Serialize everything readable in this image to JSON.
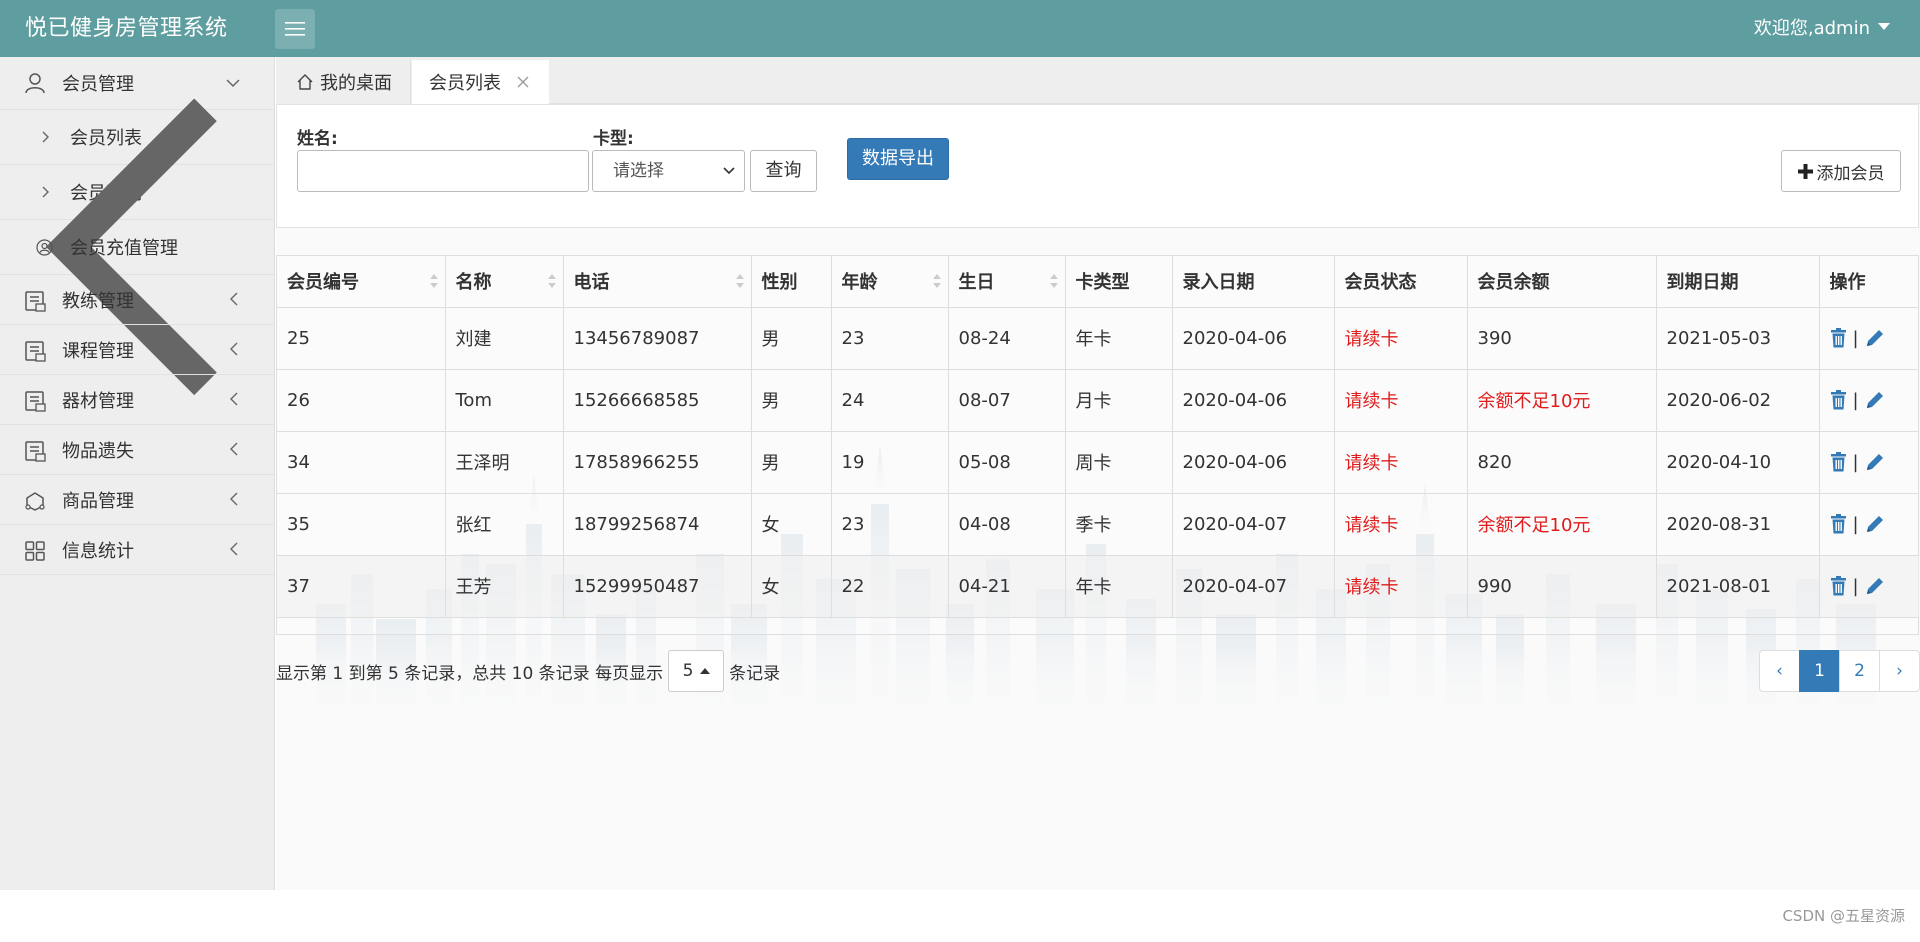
{
  "header": {
    "title": "悦已健身房管理系统",
    "welcome": "欢迎您,admin"
  },
  "sidebar": {
    "items": [
      {
        "label": "会员管理",
        "icon": "user-icon",
        "expanded": true,
        "children": [
          {
            "label": "会员列表"
          },
          {
            "label": "会员到期"
          }
        ]
      },
      {
        "label": "会员充值管理",
        "icon": "circle-user-icon"
      },
      {
        "label": "教练管理",
        "icon": "document-icon"
      },
      {
        "label": "课程管理",
        "icon": "document-icon"
      },
      {
        "label": "器材管理",
        "icon": "document-icon"
      },
      {
        "label": "物品遗失",
        "icon": "document-icon"
      },
      {
        "label": "商品管理",
        "icon": "goods-icon"
      },
      {
        "label": "信息统计",
        "icon": "grid-icon"
      }
    ]
  },
  "tabs": {
    "home": "我的桌面",
    "active": "会员列表"
  },
  "search": {
    "name_label": "姓名:",
    "name_value": "",
    "card_label": "卡型:",
    "card_selected": "请选择",
    "query_button": "查询",
    "export_button": "数据导出",
    "add_button": "添加会员"
  },
  "table": {
    "columns": [
      "会员编号",
      "名称",
      "电话",
      "性别",
      "年龄",
      "生日",
      "卡类型",
      "录入日期",
      "会员状态",
      "会员余额",
      "到期日期",
      "操作"
    ],
    "rows": [
      [
        "25",
        "刘建",
        "13456789087",
        "男",
        "23",
        "08-24",
        "年卡",
        "2020-04-06",
        "请续卡",
        "390",
        "2021-05-03"
      ],
      [
        "26",
        "Tom",
        "15266668585",
        "男",
        "24",
        "08-07",
        "月卡",
        "2020-04-06",
        "请续卡",
        "余额不足10元",
        "2020-06-02"
      ],
      [
        "34",
        "王泽明",
        "17858966255",
        "男",
        "19",
        "05-08",
        "周卡",
        "2020-04-06",
        "请续卡",
        "820",
        "2020-04-10"
      ],
      [
        "35",
        "张红",
        "18799256874",
        "女",
        "23",
        "04-08",
        "季卡",
        "2020-04-07",
        "请续卡",
        "余额不足10元",
        "2020-08-31"
      ],
      [
        "37",
        "王芳",
        "15299950487",
        "女",
        "22",
        "04-21",
        "年卡",
        "2020-04-07",
        "请续卡",
        "990",
        "2021-08-01"
      ]
    ],
    "ops_separator": "|"
  },
  "pagination": {
    "info_prefix": "显示第 1 到第 5 条记录，总共 10 条记录 每页显示",
    "page_size": "5",
    "info_suffix": "条记录",
    "prev": "‹",
    "pages": [
      "1",
      "2"
    ],
    "current": "1",
    "next": "›"
  },
  "watermark": "CSDN @五星资源",
  "colors": {
    "header_bg": "#5f9ea0",
    "primary": "#337ab7",
    "alert_red": "#e01b1b"
  }
}
